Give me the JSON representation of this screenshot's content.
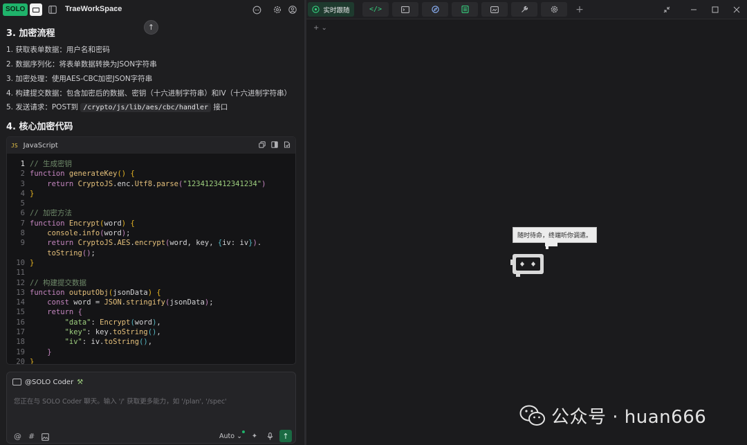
{
  "app": {
    "badge_text": "SOLO",
    "workspace": "TraeWorkSpace"
  },
  "content": {
    "section3_title": "3. 加密流程",
    "steps": [
      "1. 获取表单数据：用户名和密码",
      "2. 数据序列化：将表单数据转换为JSON字符串",
      "3. 加密处理：使用AES-CBC加密JSON字符串",
      "4. 构建提交数据：包含加密后的数据、密钥（十六进制字符串）和IV（十六进制字符串）"
    ],
    "step5_prefix": "5. 发送请求：POST到",
    "step5_code": "/crypto/js/lib/aes/cbc/handler",
    "step5_suffix": "接口",
    "section4_title": "4. 核心加密代码"
  },
  "code_block": {
    "lang_icon": "JS",
    "language": "JavaScript",
    "line_numbers": [
      "1",
      "2",
      "3",
      "4",
      "5",
      "6",
      "7",
      "8",
      "9",
      "",
      "10",
      "11",
      "12",
      "13",
      "14",
      "15",
      "16",
      "17",
      "18",
      "19",
      "20"
    ]
  },
  "chat": {
    "mention": "@SOLO Coder",
    "placeholder": "您正在与 SOLO Coder 聊天。输入 '/' 获取更多能力，如 '/plan', '/spec'",
    "model_select": "Auto"
  },
  "right_panel": {
    "active_tab_label": "实时跟随",
    "tabs": [
      "code-icon",
      "terminal-icon",
      "browser-icon",
      "docs-icon",
      "preview-icon",
      "tools-icon",
      "settings-icon"
    ],
    "sub_toolbar": "+ ⌄",
    "bubble_text": "随时待命，终端听你调遣。",
    "watermark": "公众号 · huan666"
  },
  "colors": {
    "accent": "#1fb36b",
    "active_tab_text": "#36d07f",
    "background": "#1b1b1d"
  }
}
